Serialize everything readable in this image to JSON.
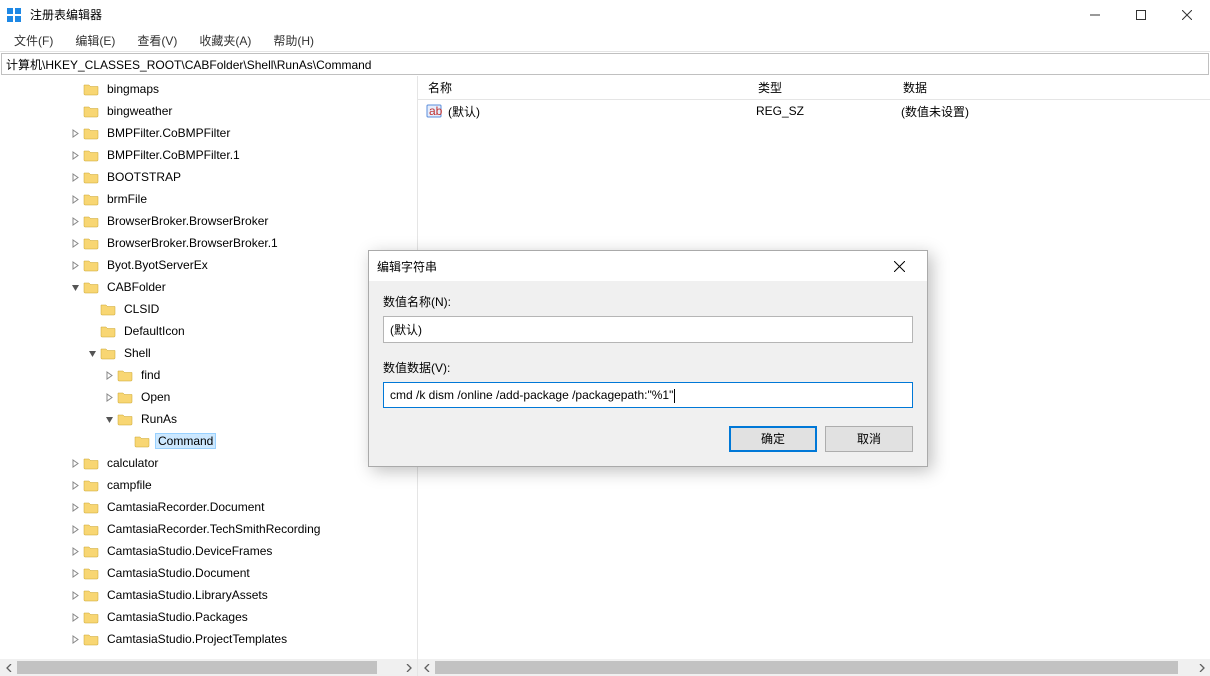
{
  "app": {
    "title": "注册表编辑器"
  },
  "menu": {
    "file": "文件(F)",
    "edit": "编辑(E)",
    "view": "查看(V)",
    "fav": "收藏夹(A)",
    "help": "帮助(H)"
  },
  "address": "计算机\\HKEY_CLASSES_ROOT\\CABFolder\\Shell\\RunAs\\Command",
  "tree": [
    {
      "depth": 3,
      "twisty": "none",
      "label": "bingmaps"
    },
    {
      "depth": 3,
      "twisty": "none",
      "label": "bingweather"
    },
    {
      "depth": 3,
      "twisty": "closed",
      "label": "BMPFilter.CoBMPFilter"
    },
    {
      "depth": 3,
      "twisty": "closed",
      "label": "BMPFilter.CoBMPFilter.1"
    },
    {
      "depth": 3,
      "twisty": "closed",
      "label": "BOOTSTRAP"
    },
    {
      "depth": 3,
      "twisty": "closed",
      "label": "brmFile"
    },
    {
      "depth": 3,
      "twisty": "closed",
      "label": "BrowserBroker.BrowserBroker"
    },
    {
      "depth": 3,
      "twisty": "closed",
      "label": "BrowserBroker.BrowserBroker.1"
    },
    {
      "depth": 3,
      "twisty": "closed",
      "label": "Byot.ByotServerEx"
    },
    {
      "depth": 3,
      "twisty": "open",
      "label": "CABFolder"
    },
    {
      "depth": 4,
      "twisty": "none",
      "label": "CLSID"
    },
    {
      "depth": 4,
      "twisty": "none",
      "label": "DefaultIcon"
    },
    {
      "depth": 4,
      "twisty": "open",
      "label": "Shell"
    },
    {
      "depth": 5,
      "twisty": "closed",
      "label": "find"
    },
    {
      "depth": 5,
      "twisty": "closed",
      "label": "Open"
    },
    {
      "depth": 5,
      "twisty": "open",
      "label": "RunAs"
    },
    {
      "depth": 6,
      "twisty": "none",
      "label": "Command",
      "selected": true
    },
    {
      "depth": 3,
      "twisty": "closed",
      "label": "calculator"
    },
    {
      "depth": 3,
      "twisty": "closed",
      "label": "campfile"
    },
    {
      "depth": 3,
      "twisty": "closed",
      "label": "CamtasiaRecorder.Document"
    },
    {
      "depth": 3,
      "twisty": "closed",
      "label": "CamtasiaRecorder.TechSmithRecording"
    },
    {
      "depth": 3,
      "twisty": "closed",
      "label": "CamtasiaStudio.DeviceFrames"
    },
    {
      "depth": 3,
      "twisty": "closed",
      "label": "CamtasiaStudio.Document"
    },
    {
      "depth": 3,
      "twisty": "closed",
      "label": "CamtasiaStudio.LibraryAssets"
    },
    {
      "depth": 3,
      "twisty": "closed",
      "label": "CamtasiaStudio.Packages"
    },
    {
      "depth": 3,
      "twisty": "closed",
      "label": "CamtasiaStudio.ProjectTemplates"
    }
  ],
  "list": {
    "head": {
      "name": "名称",
      "type": "类型",
      "data": "数据"
    },
    "rows": [
      {
        "name": "(默认)",
        "type": "REG_SZ",
        "data": "(数值未设置)"
      }
    ]
  },
  "dialog": {
    "title": "编辑字符串",
    "name_label": "数值名称(N):",
    "name_value": "(默认)",
    "data_label": "数值数据(V):",
    "data_value": "cmd /k dism /online /add-package /packagepath:\"%1\"",
    "ok": "确定",
    "cancel": "取消"
  }
}
